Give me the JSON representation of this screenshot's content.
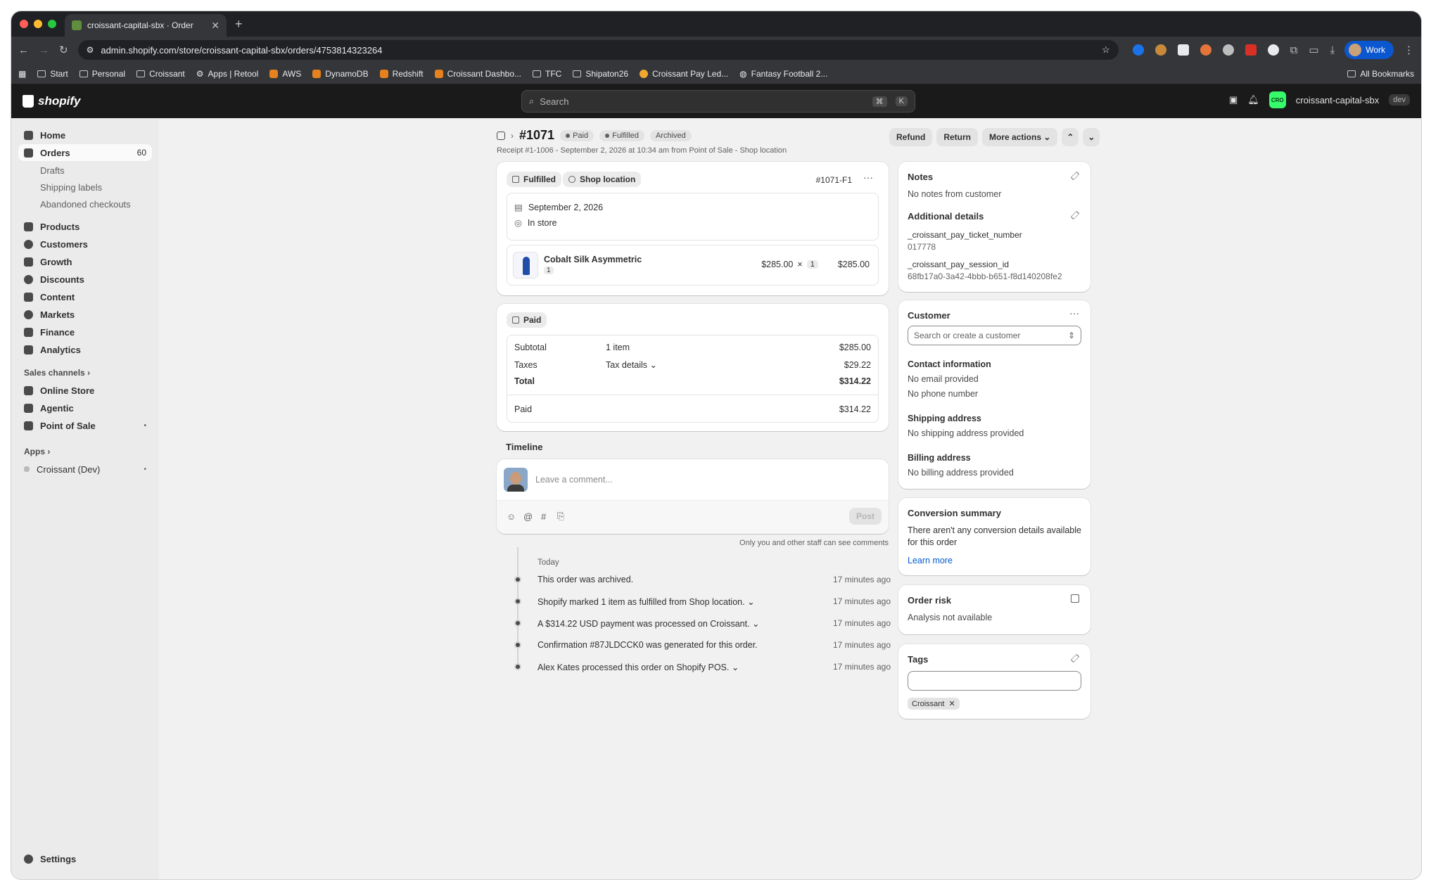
{
  "browser": {
    "tab_title": "croissant-capital-sbx · Order",
    "url": "admin.shopify.com/store/croissant-capital-sbx/orders/4753814323264",
    "profile": "Work",
    "bookmarks": [
      "Start",
      "Personal",
      "Croissant",
      "Apps | Retool",
      "AWS",
      "DynamoDB",
      "Redshift",
      "Croissant Dashbo...",
      "TFC",
      "Shipaton26",
      "Croissant Pay Led...",
      "Fantasy Football 2..."
    ],
    "all_bookmarks": "All Bookmarks"
  },
  "topbar": {
    "logo": "shopify",
    "search_placeholder": "Search",
    "shortcut_1": "⌘",
    "shortcut_2": "K",
    "store_initials": "CRO",
    "store_name": "croissant-capital-sbx",
    "env_badge": "dev"
  },
  "sidebar": {
    "items": [
      {
        "label": "Home"
      },
      {
        "label": "Orders",
        "count": "60"
      },
      {
        "label": "Drafts"
      },
      {
        "label": "Shipping labels"
      },
      {
        "label": "Abandoned checkouts"
      },
      {
        "label": "Products"
      },
      {
        "label": "Customers"
      },
      {
        "label": "Growth"
      },
      {
        "label": "Discounts"
      },
      {
        "label": "Content"
      },
      {
        "label": "Markets"
      },
      {
        "label": "Finance"
      },
      {
        "label": "Analytics"
      }
    ],
    "sales_channels_label": "Sales channels",
    "channels": [
      "Online Store",
      "Agentic",
      "Point of Sale"
    ],
    "apps_label": "Apps",
    "apps": [
      "Croissant (Dev)"
    ],
    "settings": "Settings"
  },
  "order": {
    "number": "#1071",
    "badges": [
      "Paid",
      "Fulfilled",
      "Archived"
    ],
    "subline": "Receipt #1-1006 - September 2, 2026 at 10:34 am from Point of Sale - Shop location",
    "actions": {
      "refund": "Refund",
      "return": "Return",
      "more": "More actions"
    }
  },
  "fulfillment": {
    "status": "Fulfilled",
    "location": "Shop location",
    "id": "#1071-F1",
    "date": "September 2, 2026",
    "method": "In store",
    "item": {
      "name": "Cobalt Silk Asymmetric",
      "qty_badge": "1",
      "price": "$285.00",
      "times": "×",
      "qty": "1",
      "total": "$285.00"
    }
  },
  "payment": {
    "status": "Paid",
    "subtotal_label": "Subtotal",
    "subtotal_detail": "1 item",
    "subtotal": "$285.00",
    "taxes_label": "Taxes",
    "taxes_detail": "Tax details",
    "taxes": "$29.22",
    "total_label": "Total",
    "total": "$314.22",
    "paid_label": "Paid",
    "paid": "$314.22"
  },
  "timeline": {
    "title": "Timeline",
    "comment_placeholder": "Leave a comment...",
    "post": "Post",
    "note": "Only you and other staff can see comments",
    "day": "Today",
    "events": [
      {
        "text": "This order was archived.",
        "time": "17 minutes ago"
      },
      {
        "text": "Shopify marked 1 item as fulfilled from Shop location.",
        "time": "17 minutes ago"
      },
      {
        "text": "A $314.22 USD payment was processed on Croissant.",
        "time": "17 minutes ago"
      },
      {
        "text": "Confirmation #87JLDCCK0 was generated for this order.",
        "time": "17 minutes ago"
      },
      {
        "text": "Alex Kates processed this order on Shopify POS.",
        "time": "17 minutes ago"
      }
    ]
  },
  "notes": {
    "title": "Notes",
    "text": "No notes from customer",
    "additional_title": "Additional details",
    "k1": "_croissant_pay_ticket_number",
    "v1": "017778",
    "k2": "_croissant_pay_session_id",
    "v2": "68fb17a0-3a42-4bbb-b651-f8d140208fe2"
  },
  "customer": {
    "title": "Customer",
    "search_placeholder": "Search or create a customer",
    "contact_title": "Contact information",
    "email": "No email provided",
    "phone": "No phone number",
    "shipping_title": "Shipping address",
    "shipping": "No shipping address provided",
    "billing_title": "Billing address",
    "billing": "No billing address provided"
  },
  "conversion": {
    "title": "Conversion summary",
    "text": "There aren't any conversion details available for this order",
    "link": "Learn more"
  },
  "risk": {
    "title": "Order risk",
    "text": "Analysis not available"
  },
  "tags": {
    "title": "Tags",
    "tag": "Croissant"
  },
  "colors": {
    "link": "#005bd3",
    "topbar": "#1a1a1a",
    "store_avatar": "#36fb6a"
  }
}
